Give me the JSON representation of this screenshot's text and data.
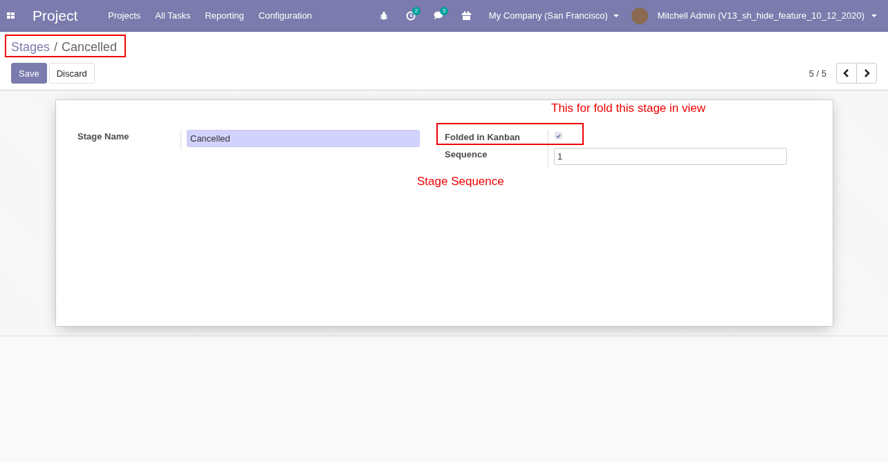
{
  "navbar": {
    "app_title": "Project",
    "menu": [
      "Projects",
      "All Tasks",
      "Reporting",
      "Configuration"
    ],
    "activity_count": "2",
    "message_count": "3",
    "company": "My Company (San Francisco)",
    "user": "Mitchell Admin (V13_sh_hide_feature_10_12_2020)"
  },
  "control_panel": {
    "breadcrumb": [
      {
        "label": "Stages",
        "kind": "link"
      },
      {
        "label": "Cancelled",
        "kind": "current"
      }
    ],
    "breadcrumb_separator": "/",
    "buttons": [
      {
        "label": "Save",
        "kind": "primary"
      },
      {
        "label": "Discard",
        "kind": "secondary"
      }
    ],
    "pager": "5 / 5"
  },
  "form": {
    "stage_name": {
      "label": "Stage Name",
      "value": "Cancelled"
    },
    "folded": {
      "label": "Folded in Kanban",
      "checked": true
    },
    "sequence": {
      "label": "Sequence",
      "value": "1"
    }
  },
  "annotations": [
    {
      "text": "This for fold this stage in view"
    },
    {
      "text": "Stage Sequence"
    }
  ]
}
